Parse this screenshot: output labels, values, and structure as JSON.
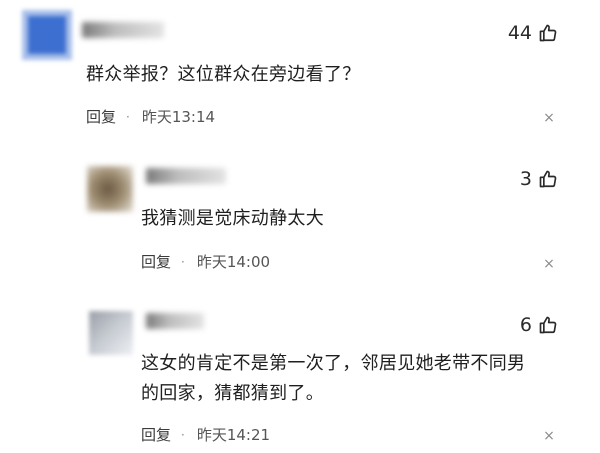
{
  "comments": [
    {
      "likes": "44",
      "text": "群众举报？这位群众在旁边看了？",
      "reply_label": "回复",
      "separator": "·",
      "time": "昨天13:14"
    },
    {
      "likes": "3",
      "text": "我猜测是觉床动静太大",
      "reply_label": "回复",
      "separator": "·",
      "time": "昨天14:00"
    },
    {
      "likes": "6",
      "text_lines": [
        "这女的肯定不是第一次了，邻居见她老带不同男",
        "的回家，猜都猜到了。"
      ],
      "reply_label": "回复",
      "separator": "·",
      "time": "昨天14:21"
    }
  ],
  "icons": {
    "like": "thumbs-up-icon",
    "dismiss": "close-icon"
  },
  "close_glyph": "×",
  "colors": {
    "text": "#1f1f1f",
    "meta": "#3b3b3b",
    "close": "#8a8a8a"
  }
}
